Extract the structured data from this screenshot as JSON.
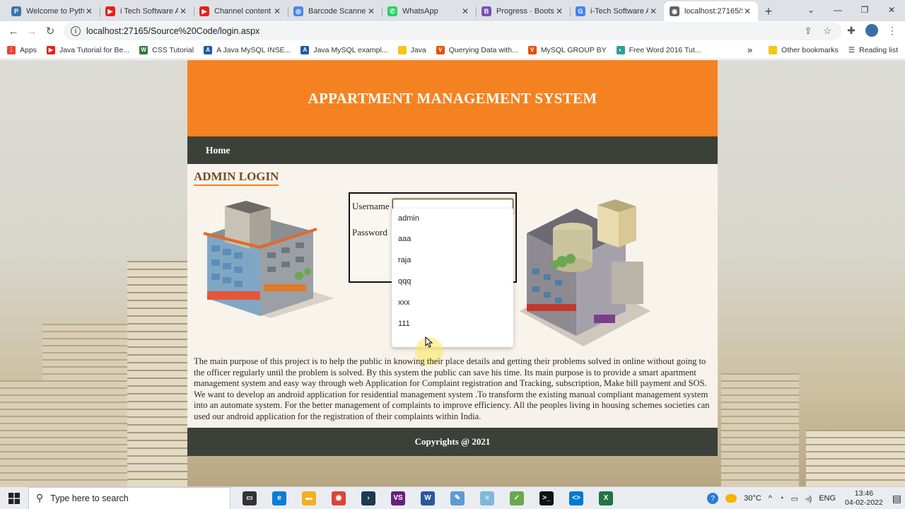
{
  "browser": {
    "tabs": [
      {
        "title": "Welcome to Pyth",
        "color": "#3a75a8",
        "glyph": "P",
        "active": false
      },
      {
        "title": "i Tech Software A",
        "color": "#e62117",
        "glyph": "▶",
        "active": false
      },
      {
        "title": "Channel content",
        "color": "#e62117",
        "glyph": "▶",
        "active": false
      },
      {
        "title": "Barcode Scanner",
        "color": "#4a86e8",
        "glyph": "◎",
        "active": false
      },
      {
        "title": "WhatsApp",
        "color": "#25d366",
        "glyph": "✆",
        "active": false
      },
      {
        "title": "Progress · Boots",
        "color": "#7952b3",
        "glyph": "B",
        "active": false
      },
      {
        "title": "i-Tech Software A",
        "color": "#4285f4",
        "glyph": "G",
        "active": false
      },
      {
        "title": "localhost:27165/S",
        "color": "#5f6368",
        "glyph": "◉",
        "active": true
      }
    ],
    "url": "localhost:27165/Source%20Code/login.aspx",
    "bookmarks": [
      {
        "label": "Apps",
        "color": "#ea4335",
        "glyph": "⋮"
      },
      {
        "label": "Java Tutorial for Be...",
        "color": "#e62117",
        "glyph": "▶"
      },
      {
        "label": "CSS Tutorial",
        "color": "#2e7d32",
        "glyph": "W"
      },
      {
        "label": "A Java MySQL INSE...",
        "color": "#1e5aa8",
        "glyph": "A"
      },
      {
        "label": "Java MySQL exampl...",
        "color": "#1e5aa8",
        "glyph": "A"
      },
      {
        "label": "Java",
        "color": "#f5c518",
        "glyph": ""
      },
      {
        "label": "Querying Data with...",
        "color": "#e65100",
        "glyph": "V"
      },
      {
        "label": "MySQL GROUP BY",
        "color": "#e65100",
        "glyph": "V"
      },
      {
        "label": "Free Word 2016 Tut...",
        "color": "#2aa198",
        "glyph": "◐"
      }
    ],
    "bookmarks_more": "»",
    "other_bookmarks": "Other bookmarks",
    "reading_list": "Reading list"
  },
  "site": {
    "title": "APPARTMENT MANAGEMENT SYSTEM",
    "nav_home": "Home",
    "heading": "ADMIN LOGIN",
    "username_label": "Username",
    "password_label": "Password",
    "username_value": "",
    "suggestions": [
      "admin",
      "aaa",
      "raja",
      "qqq",
      "xxx",
      "111"
    ],
    "description": "The main purpose of this project is to help the public in knowing their place details and getting their problems solved in online without going to the officer regularly until the problem is solved. By this system the public can save his time. Its main purpose is to provide a smart apartment management system and easy way through web Application for Complaint registration and Tracking, subscription, Make bill payment and SOS. We want to develop an android application for residential management system .To transform the existing manual compliant management system into an automate system. For the better management of complaints to improve efficiency. All the peoples living in housing schemes societies can used our android application for the registration of their complaints within India.",
    "footer": "Copyrights @ 2021"
  },
  "taskbar": {
    "search_placeholder": "Type here to search",
    "temperature": "30°C",
    "language": "ENG",
    "time": "13:46",
    "date": "04-02-2022",
    "apps": [
      {
        "name": "task-view",
        "color": "#333",
        "glyph": "▭"
      },
      {
        "name": "edge",
        "color": "#0c7cd5",
        "glyph": "e"
      },
      {
        "name": "file-explorer",
        "color": "#f2b01e",
        "glyph": "▬"
      },
      {
        "name": "chrome",
        "color": "#db4437",
        "glyph": "◉"
      },
      {
        "name": "terminal",
        "color": "#1b3b4f",
        "glyph": "›"
      },
      {
        "name": "visual-studio",
        "color": "#68217a",
        "glyph": "VS"
      },
      {
        "name": "word",
        "color": "#2b579a",
        "glyph": "W"
      },
      {
        "name": "paint",
        "color": "#5b9bd5",
        "glyph": "✎"
      },
      {
        "name": "notepad",
        "color": "#7fb8d8",
        "glyph": "≡"
      },
      {
        "name": "sticky-app",
        "color": "#69a84f",
        "glyph": "✓"
      },
      {
        "name": "cmd",
        "color": "#111",
        "glyph": ">_"
      },
      {
        "name": "vscode",
        "color": "#0078d4",
        "glyph": "<>"
      },
      {
        "name": "excel",
        "color": "#217346",
        "glyph": "X"
      }
    ]
  }
}
